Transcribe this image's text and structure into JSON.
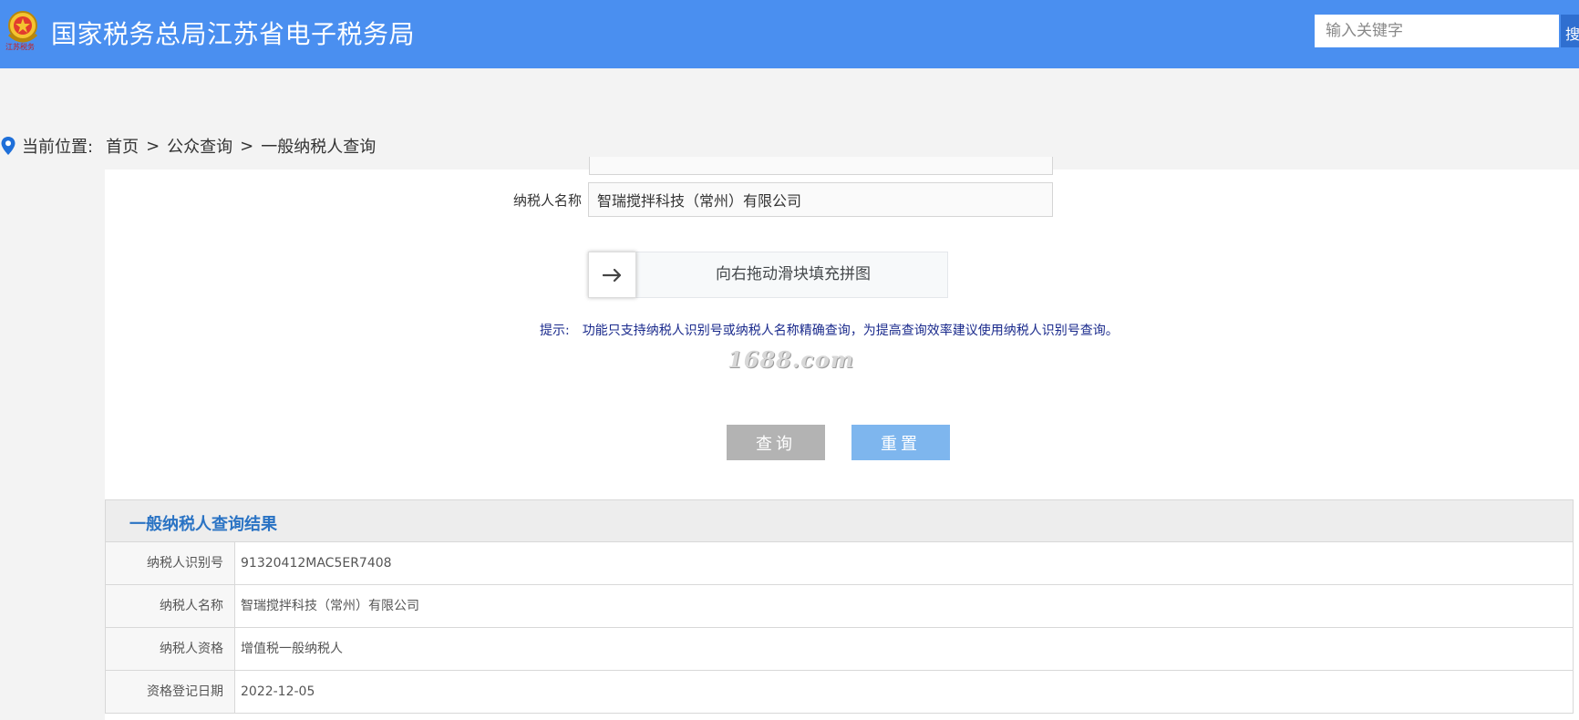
{
  "header": {
    "logo_text": "江苏税务",
    "title": "国家税务总局江苏省电子税务局",
    "search_placeholder": "输入关键字",
    "search_button_label": "搜"
  },
  "breadcrumb": {
    "prefix": "当前位置:",
    "items": [
      "首页",
      "公众查询",
      "一般纳税人查询"
    ],
    "separator": ">"
  },
  "form": {
    "name_label": "纳税人名称",
    "name_value": "智瑞搅拌科技（常州）有限公司",
    "slider_text": "向右拖动滑块填充拼图",
    "hint_label": "提示:",
    "hint_text": "功能只支持纳税人识别号或纳税人名称精确查询，为提高查询效率建议使用纳税人识别号查询。",
    "watermark": "1688.com",
    "query_button": "查询",
    "reset_button": "重置"
  },
  "result": {
    "title": "一般纳税人查询结果",
    "rows": [
      {
        "label": "纳税人识别号",
        "value": "91320412MAC5ER7408"
      },
      {
        "label": "纳税人名称",
        "value": "智瑞搅拌科技（常州）有限公司"
      },
      {
        "label": "纳税人资格",
        "value": "增值税一般纳税人"
      },
      {
        "label": "资格登记日期",
        "value": "2022-12-05"
      }
    ]
  },
  "colors": {
    "header_bg": "#4a8ff0",
    "result_title": "#2a73c4",
    "hint_text": "#1a2a8c",
    "reset_button": "#7eb6ee",
    "query_button": "#b3b3b3"
  },
  "icons": {
    "logo": "tax-emblem-icon",
    "breadcrumb": "location-pin-icon",
    "slider": "arrow-right-icon"
  }
}
